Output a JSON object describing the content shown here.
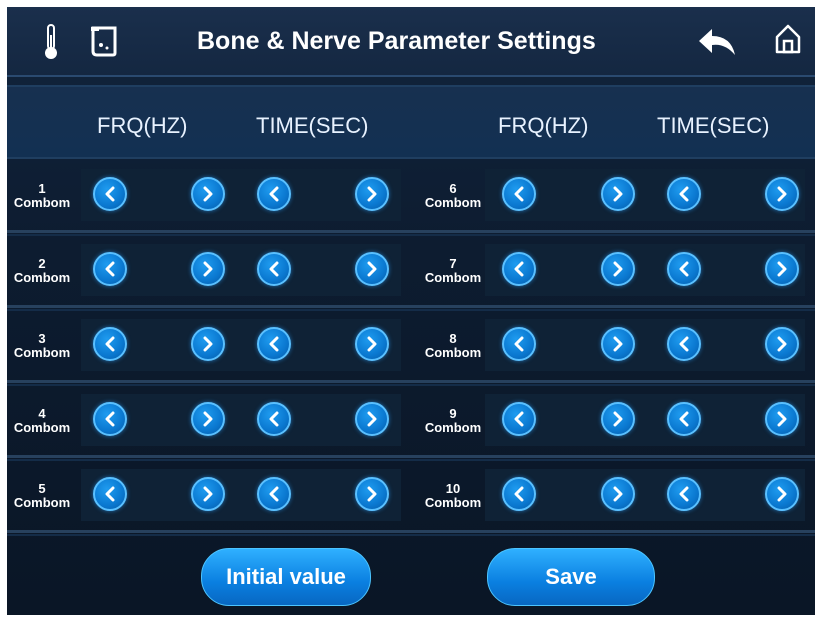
{
  "header": {
    "title": "Bone & Nerve Parameter Settings",
    "icons": [
      "thermometer-icon",
      "beaker-icon",
      "back-arrow-icon",
      "home-icon"
    ]
  },
  "columns": {
    "left_frq": "FRQ(HZ)",
    "left_time": "TIME(SEC)",
    "right_frq": "FRQ(HZ)",
    "right_time": "TIME(SEC)"
  },
  "rows_left": [
    {
      "num": "1",
      "label": "Combom"
    },
    {
      "num": "2",
      "label": "Combom"
    },
    {
      "num": "3",
      "label": "Combom"
    },
    {
      "num": "4",
      "label": "Combom"
    },
    {
      "num": "5",
      "label": "Combom"
    }
  ],
  "rows_right": [
    {
      "num": "6",
      "label": "Combom"
    },
    {
      "num": "7",
      "label": "Combom"
    },
    {
      "num": "8",
      "label": "Combom"
    },
    {
      "num": "9",
      "label": "Combom"
    },
    {
      "num": "10",
      "label": "Combom"
    }
  ],
  "buttons": {
    "initial": "Initial value",
    "save": "Save"
  },
  "colors": {
    "accent": "#0a7fe0",
    "background": "#0d1c30"
  }
}
